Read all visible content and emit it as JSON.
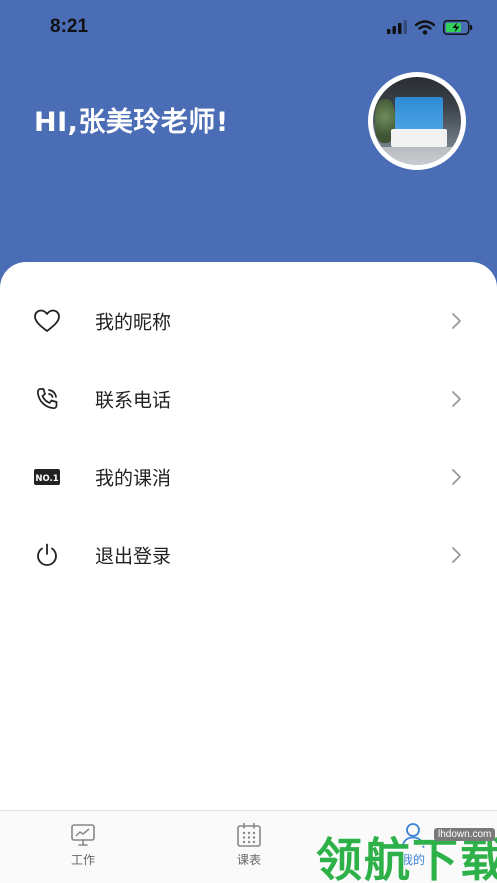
{
  "status_bar": {
    "time": "8:21"
  },
  "profile": {
    "greeting": "HI,张美玲老师!"
  },
  "menu": {
    "items": [
      {
        "label": "我的昵称",
        "icon": "heart-icon"
      },
      {
        "label": "联系电话",
        "icon": "phone-icon"
      },
      {
        "label": "我的课消",
        "icon": "no1-icon",
        "icon_text": "NO.1"
      },
      {
        "label": "退出登录",
        "icon": "power-icon"
      }
    ]
  },
  "tabbar": {
    "tabs": [
      {
        "label": "工作",
        "icon": "monitor-chart-icon"
      },
      {
        "label": "课表",
        "icon": "calendar-icon"
      },
      {
        "label": "我的",
        "icon": "person-icon",
        "active": true
      }
    ]
  },
  "watermark": {
    "text": "领航下载",
    "url": "lhdown.com"
  },
  "colors": {
    "header_bg": "#4a6db5",
    "active_tab": "#3b82d6",
    "watermark_green": "#2fb14a"
  }
}
